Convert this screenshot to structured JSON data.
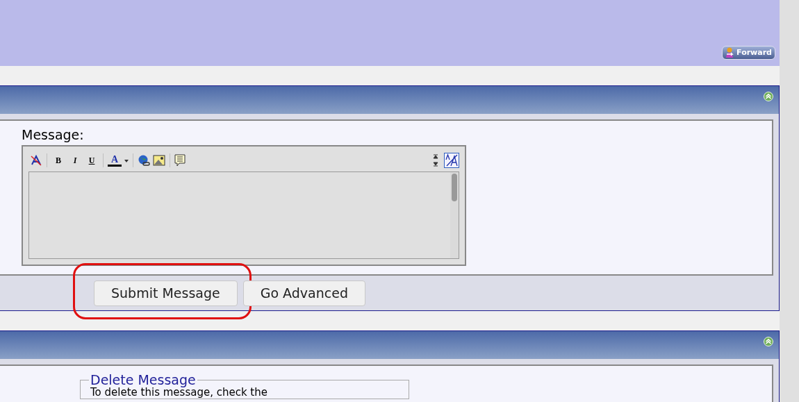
{
  "header": {
    "forward_button": "Forward"
  },
  "quick_reply": {
    "label": "Message:",
    "toolbar": [
      {
        "kind": "remove-format"
      },
      {
        "kind": "sep"
      },
      {
        "kind": "bold",
        "text": "B"
      },
      {
        "kind": "italic",
        "text": "I"
      },
      {
        "kind": "underline",
        "text": "U"
      },
      {
        "kind": "sep"
      },
      {
        "kind": "color",
        "text": "A"
      },
      {
        "kind": "sep"
      },
      {
        "kind": "link"
      },
      {
        "kind": "image"
      },
      {
        "kind": "sep"
      },
      {
        "kind": "quote"
      }
    ],
    "buttons": [
      {
        "label": "Submit Message",
        "highlighted": true
      },
      {
        "label": "Go Advanced",
        "highlighted": false
      }
    ]
  },
  "delete_panel": {
    "legend": "Delete Message",
    "text": "To delete this message, check the"
  }
}
